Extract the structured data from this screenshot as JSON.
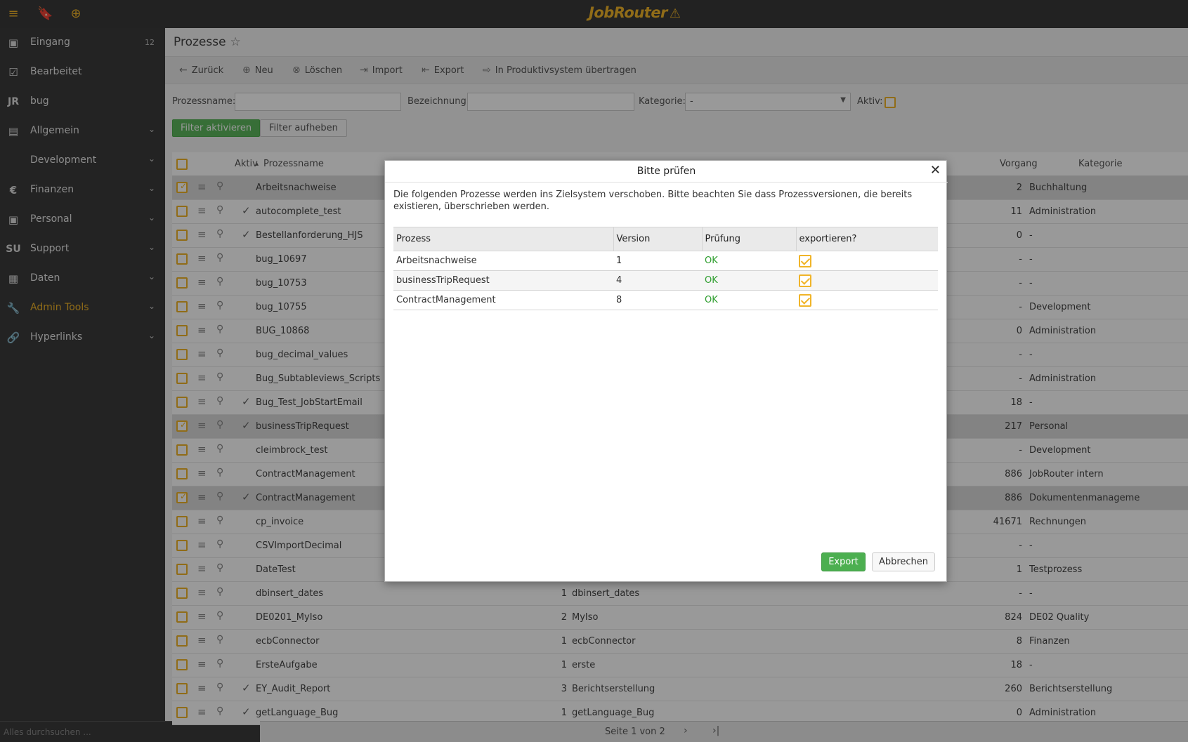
{
  "topbar": {
    "logo_text": "JobRouter",
    "logo_badge": "⚠",
    "menu_icon": "menu-icon",
    "bookmark_icon": "bookmark-icon",
    "add_icon": "plus-circle-icon"
  },
  "sidebar": {
    "items": [
      {
        "label": "Eingang",
        "icon": "inbox-icon",
        "glyph": "▣",
        "count": "12"
      },
      {
        "label": "Bearbeitet",
        "icon": "checked-box-icon",
        "glyph": "☑"
      },
      {
        "label": "bug",
        "icon": "jr-icon",
        "glyph": "JR"
      },
      {
        "label": "Allgemein",
        "icon": "list-icon",
        "glyph": "▤"
      },
      {
        "label": "Development",
        "icon": "",
        "glyph": ""
      },
      {
        "label": "Finanzen",
        "icon": "euro-icon",
        "glyph": "€"
      },
      {
        "label": "Personal",
        "icon": "person-card-icon",
        "glyph": "▣"
      },
      {
        "label": "Support",
        "icon": "su-icon",
        "glyph": "SU"
      },
      {
        "label": "Daten",
        "icon": "table-icon",
        "glyph": "▦"
      },
      {
        "label": "Admin Tools",
        "icon": "wrench-icon",
        "glyph": "🔧"
      },
      {
        "label": "Hyperlinks",
        "icon": "link-icon",
        "glyph": "🔗"
      }
    ],
    "search_placeholder": "Alles durchsuchen ..."
  },
  "main": {
    "title": "Prozesse",
    "toolbar": {
      "back": "Zurück",
      "new": "Neu",
      "delete": "Löschen",
      "import": "Import",
      "export": "Export",
      "transfer": "In Produktivsystem übertragen"
    },
    "filters": {
      "processname_label": "Prozessname:",
      "bezeichnung_label": "Bezeichnung:",
      "kategorie_label": "Kategorie:",
      "kategorie_value": "-",
      "aktiv_label": "Aktiv:",
      "activate_button": "Filter aktivieren",
      "clear_button": "Filter aufheben"
    },
    "grid": {
      "headers": {
        "aktiv": "Aktiv",
        "prozessname": "Prozessname",
        "vorgang": "Vorgang",
        "kategorie": "Kategorie"
      },
      "sort_indicator": "▴",
      "rows": [
        {
          "name": "Arbeitsnachweise",
          "selected": true,
          "active": false,
          "version": "",
          "bez": "",
          "vorgang": "2",
          "kategorie": "Buchhaltung"
        },
        {
          "name": "autocomplete_test",
          "selected": false,
          "active": true,
          "version": "",
          "bez": "",
          "vorgang": "11",
          "kategorie": "Administration"
        },
        {
          "name": "Bestellanforderung_HJS",
          "selected": false,
          "active": true,
          "version": "",
          "bez": "",
          "vorgang": "0",
          "kategorie": "-"
        },
        {
          "name": "bug_10697",
          "selected": false,
          "active": false,
          "version": "",
          "bez": "",
          "vorgang": "-",
          "kategorie": "-"
        },
        {
          "name": "bug_10753",
          "selected": false,
          "active": false,
          "version": "",
          "bez": "",
          "vorgang": "-",
          "kategorie": "-"
        },
        {
          "name": "bug_10755",
          "selected": false,
          "active": false,
          "version": "",
          "bez": "",
          "vorgang": "-",
          "kategorie": "Development"
        },
        {
          "name": "BUG_10868",
          "selected": false,
          "active": false,
          "version": "",
          "bez": "",
          "vorgang": "0",
          "kategorie": "Administration"
        },
        {
          "name": "bug_decimal_values",
          "selected": false,
          "active": false,
          "version": "",
          "bez": "",
          "vorgang": "-",
          "kategorie": "-"
        },
        {
          "name": "Bug_Subtableviews_Scripts",
          "selected": false,
          "active": false,
          "version": "",
          "bez": "",
          "vorgang": "-",
          "kategorie": "Administration"
        },
        {
          "name": "Bug_Test_JobStartEmail",
          "selected": false,
          "active": true,
          "version": "",
          "bez": "",
          "vorgang": "18",
          "kategorie": "-"
        },
        {
          "name": "businessTripRequest",
          "selected": true,
          "active": true,
          "version": "",
          "bez": "",
          "vorgang": "217",
          "kategorie": "Personal"
        },
        {
          "name": "cleimbrock_test",
          "selected": false,
          "active": false,
          "version": "",
          "bez": "",
          "vorgang": "-",
          "kategorie": "Development"
        },
        {
          "name": "ContractManagement",
          "selected": false,
          "active": false,
          "version": "",
          "bez": "",
          "vorgang": "886",
          "kategorie": "JobRouter intern"
        },
        {
          "name": "ContractManagement",
          "selected": true,
          "active": true,
          "version": "",
          "bez": "",
          "vorgang": "886",
          "kategorie": "Dokumentenmanageme"
        },
        {
          "name": "cp_invoice",
          "selected": false,
          "active": false,
          "version": "",
          "bez": "",
          "vorgang": "41671",
          "kategorie": "Rechnungen"
        },
        {
          "name": "CSVImportDecimal",
          "selected": false,
          "active": false,
          "version": "",
          "bez": "",
          "vorgang": "-",
          "kategorie": "-"
        },
        {
          "name": "DateTest",
          "selected": false,
          "active": false,
          "version": "",
          "bez": "",
          "vorgang": "1",
          "kategorie": "Testprozess"
        },
        {
          "name": "dbinsert_dates",
          "selected": false,
          "active": false,
          "version": "1",
          "bez": "dbinsert_dates",
          "vorgang": "-",
          "kategorie": "-"
        },
        {
          "name": "DE0201_MyIso",
          "selected": false,
          "active": false,
          "version": "2",
          "bez": "MyIso",
          "vorgang": "824",
          "kategorie": "DE02 Quality"
        },
        {
          "name": "ecbConnector",
          "selected": false,
          "active": false,
          "version": "1",
          "bez": "ecbConnector",
          "vorgang": "8",
          "kategorie": "Finanzen"
        },
        {
          "name": "ErsteAufgabe",
          "selected": false,
          "active": false,
          "version": "1",
          "bez": "erste",
          "vorgang": "18",
          "kategorie": "-"
        },
        {
          "name": "EY_Audit_Report",
          "selected": false,
          "active": true,
          "version": "3",
          "bez": "Berichtserstellung",
          "vorgang": "260",
          "kategorie": "Berichtserstellung"
        },
        {
          "name": "getLanguage_Bug",
          "selected": false,
          "active": true,
          "version": "1",
          "bez": "getLanguage_Bug",
          "vorgang": "0",
          "kategorie": "Administration"
        }
      ]
    },
    "footer": {
      "page_text": "Seite 1 von 2",
      "next": "›",
      "last": "›|"
    }
  },
  "modal": {
    "title": "Bitte prüfen",
    "close": "✕",
    "description": "Die folgenden Prozesse werden ins Zielsystem verschoben. Bitte beachten Sie dass Prozessversionen, die bereits existieren, überschrieben werden.",
    "columns": [
      "Prozess",
      "Version",
      "Prüfung",
      "exportieren?"
    ],
    "rows": [
      {
        "prozess": "Arbeitsnachweise",
        "version": "1",
        "pruefung": "OK",
        "export": true
      },
      {
        "prozess": "businessTripRequest",
        "version": "4",
        "pruefung": "OK",
        "export": true
      },
      {
        "prozess": "ContractManagement",
        "version": "8",
        "pruefung": "OK",
        "export": true
      }
    ],
    "export_button": "Export",
    "cancel_button": "Abbrechen"
  },
  "colors": {
    "accent": "#f0b429",
    "ok_green": "#2e9e2e",
    "button_green": "#4caf50"
  }
}
